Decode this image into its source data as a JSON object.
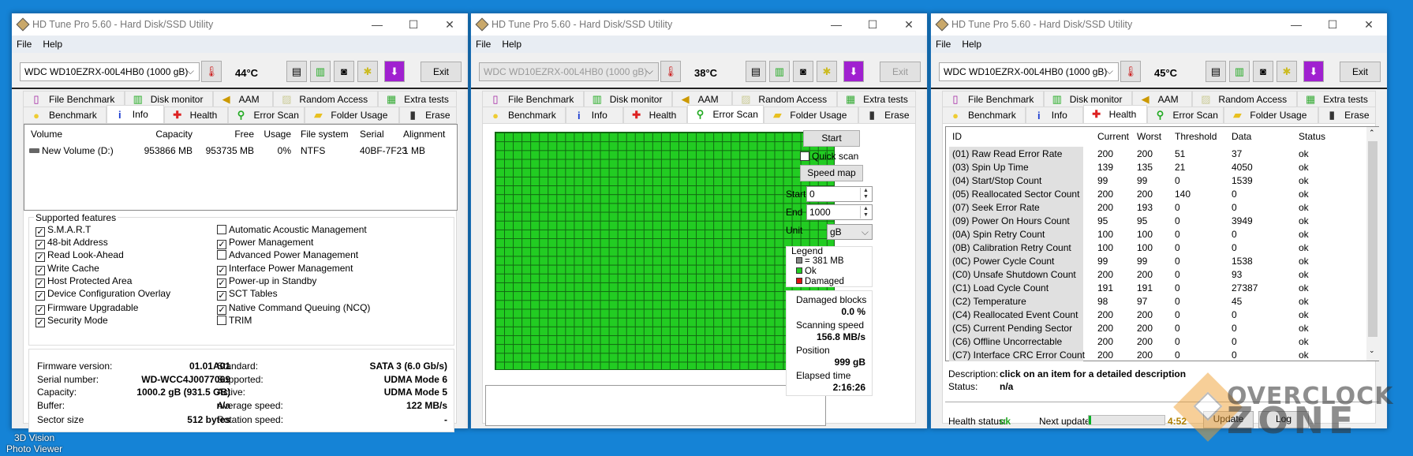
{
  "desktop": {
    "icons": [
      "3D Vision",
      "Photo Viewer"
    ]
  },
  "app_title": "HD Tune Pro 5.60 - Hard Disk/SSD Utility",
  "menu": {
    "file": "File",
    "help": "Help"
  },
  "drive": "WDC WD10EZRX-00L4HB0 (1000 gB)",
  "exit_label": "Exit",
  "tabs_row1": [
    {
      "label": "File Benchmark",
      "icon": "file-benchmark-icon"
    },
    {
      "label": "Disk monitor",
      "icon": "disk-monitor-icon"
    },
    {
      "label": "AAM",
      "icon": "speaker-icon"
    },
    {
      "label": "Random Access",
      "icon": "random-access-icon"
    },
    {
      "label": "Extra tests",
      "icon": "extra-tests-icon"
    }
  ],
  "tabs_row2": [
    {
      "label": "Benchmark",
      "icon": "lightbulb-icon"
    },
    {
      "label": "Info",
      "icon": "info-icon"
    },
    {
      "label": "Health",
      "icon": "red-cross-icon"
    },
    {
      "label": "Error Scan",
      "icon": "magnifier-icon"
    },
    {
      "label": "Folder Usage",
      "icon": "folder-icon"
    },
    {
      "label": "Erase",
      "icon": "trash-icon"
    }
  ],
  "windows": [
    {
      "temperature": "44°C",
      "active_tab": "Info"
    },
    {
      "temperature": "38°C",
      "active_tab": "Error Scan"
    },
    {
      "temperature": "45°C",
      "active_tab": "Health"
    }
  ],
  "info": {
    "volume_columns": [
      "Volume",
      "Capacity",
      "Free",
      "Usage",
      "File system",
      "Serial",
      "Alignment"
    ],
    "volumes": [
      [
        "New Volume (D:)",
        "953866 MB",
        "953735 MB",
        "0%",
        "NTFS",
        "40BF-7F23",
        "1 MB"
      ]
    ],
    "features_title": "Supported features",
    "features_left": [
      {
        "label": "S.M.A.R.T",
        "checked": true
      },
      {
        "label": "48-bit Address",
        "checked": true
      },
      {
        "label": "Read Look-Ahead",
        "checked": true
      },
      {
        "label": "Write Cache",
        "checked": true
      },
      {
        "label": "Host Protected Area",
        "checked": true
      },
      {
        "label": "Device Configuration Overlay",
        "checked": true
      },
      {
        "label": "Firmware Upgradable",
        "checked": true
      },
      {
        "label": "Security Mode",
        "checked": true
      }
    ],
    "features_right": [
      {
        "label": "Automatic Acoustic Management",
        "checked": false
      },
      {
        "label": "Power Management",
        "checked": true
      },
      {
        "label": "Advanced Power Management",
        "checked": false
      },
      {
        "label": "Interface Power Management",
        "checked": true
      },
      {
        "label": "Power-up in Standby",
        "checked": true
      },
      {
        "label": "SCT Tables",
        "checked": true
      },
      {
        "label": "Native Command Queuing (NCQ)",
        "checked": true
      },
      {
        "label": "TRIM",
        "checked": false
      }
    ],
    "details_left": [
      [
        "Firmware version:",
        "01.01A01"
      ],
      [
        "Serial number:",
        "WD-WCC4J0077069"
      ],
      [
        "Capacity:",
        "1000.2 gB (931.5 GB)"
      ],
      [
        "Buffer:",
        "n/a"
      ],
      [
        "Sector size",
        "512 bytes"
      ]
    ],
    "details_right": [
      [
        "Standard:",
        "SATA 3 (6.0 Gb/s)"
      ],
      [
        "Supported:",
        "UDMA Mode 6"
      ],
      [
        "Active:",
        "UDMA Mode 5"
      ],
      [
        "Average speed:",
        "122 MB/s"
      ],
      [
        "Rotation speed:",
        "-"
      ]
    ]
  },
  "error_scan": {
    "start_button": "Start",
    "quick_scan": "Quick scan",
    "quick_scan_checked": false,
    "speed_map_button": "Speed map",
    "start_label": "Start",
    "start_value": "0",
    "end_label": "End",
    "end_value": "1000",
    "unit_label": "Unit",
    "unit_value": "gB",
    "legend_title": "Legend",
    "legend_block": "= 381 MB",
    "legend_ok": "Ok",
    "legend_damaged": "Damaged",
    "colors": {
      "ok": "#22cc22",
      "damaged": "#dd1111",
      "block": "#888888"
    },
    "damaged_blocks_label": "Damaged blocks",
    "damaged_blocks": "0.0 %",
    "scanning_speed_label": "Scanning speed",
    "scanning_speed": "156.8 MB/s",
    "position_label": "Position",
    "position": "999 gB",
    "elapsed_label": "Elapsed time",
    "elapsed": "2:16:26",
    "scan_progress_percent": 100
  },
  "health": {
    "columns": [
      "ID",
      "Current",
      "Worst",
      "Threshold",
      "Data",
      "Status"
    ],
    "rows": [
      [
        "(01) Raw Read Error Rate",
        "200",
        "200",
        "51",
        "37",
        "ok"
      ],
      [
        "(03) Spin Up Time",
        "139",
        "135",
        "21",
        "4050",
        "ok"
      ],
      [
        "(04) Start/Stop Count",
        "99",
        "99",
        "0",
        "1539",
        "ok"
      ],
      [
        "(05) Reallocated Sector Count",
        "200",
        "200",
        "140",
        "0",
        "ok"
      ],
      [
        "(07) Seek Error Rate",
        "200",
        "193",
        "0",
        "0",
        "ok"
      ],
      [
        "(09) Power On Hours Count",
        "95",
        "95",
        "0",
        "3949",
        "ok"
      ],
      [
        "(0A) Spin Retry Count",
        "100",
        "100",
        "0",
        "0",
        "ok"
      ],
      [
        "(0B) Calibration Retry Count",
        "100",
        "100",
        "0",
        "0",
        "ok"
      ],
      [
        "(0C) Power Cycle Count",
        "99",
        "99",
        "0",
        "1538",
        "ok"
      ],
      [
        "(C0) Unsafe Shutdown Count",
        "200",
        "200",
        "0",
        "93",
        "ok"
      ],
      [
        "(C1) Load Cycle Count",
        "191",
        "191",
        "0",
        "27387",
        "ok"
      ],
      [
        "(C2) Temperature",
        "98",
        "97",
        "0",
        "45",
        "ok"
      ],
      [
        "(C4) Reallocated Event Count",
        "200",
        "200",
        "0",
        "0",
        "ok"
      ],
      [
        "(C5) Current Pending Sector",
        "200",
        "200",
        "0",
        "0",
        "ok"
      ],
      [
        "(C6) Offline Uncorrectable",
        "200",
        "200",
        "0",
        "0",
        "ok"
      ],
      [
        "(C7) Interface CRC Error Count",
        "200",
        "200",
        "0",
        "0",
        "ok"
      ]
    ],
    "description_label": "Description:",
    "description": "click on an item for a detailed description",
    "status_label": "Status:",
    "status": "n/a",
    "health_status_label": "Health status:",
    "health_status": "ok",
    "next_update_label": "Next update:",
    "next_update": "4:52",
    "next_update_progress_percent": 3,
    "update_button": "Update",
    "log_button": "Log"
  },
  "watermark": "OVERCLOCK ZONE"
}
